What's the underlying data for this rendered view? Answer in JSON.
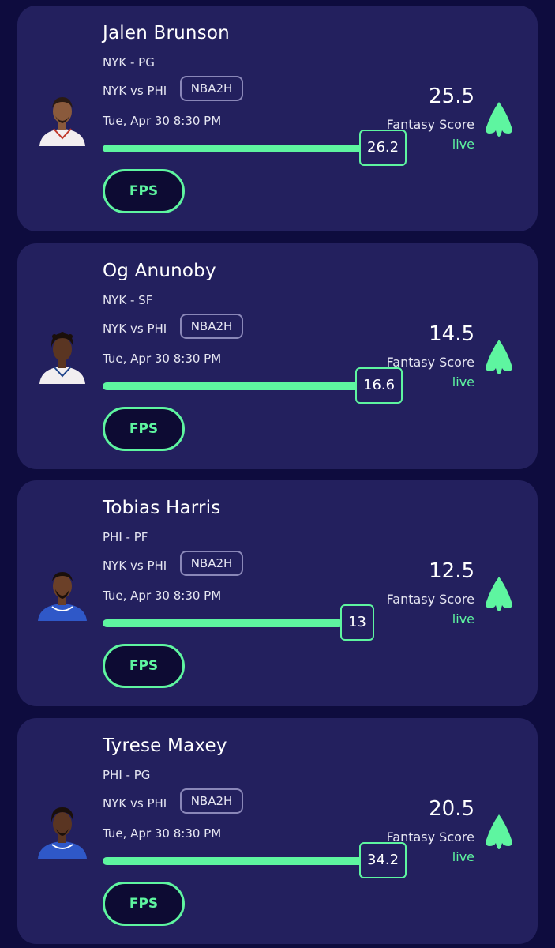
{
  "cards": [
    {
      "player_name": "Jalen Brunson",
      "team_position": "NYK - PG",
      "matchup": "NYK vs PHI",
      "league": "NBA2H",
      "datetime": "Tue, Apr 30 8:30 PM",
      "current_value": "26.2",
      "line_value": "25.5",
      "score_label": "Fantasy Score",
      "status": "live",
      "button_label": "FPS",
      "jersey_color": "#f2eef0",
      "skin_color": "#8a5a3c"
    },
    {
      "player_name": "Og Anunoby",
      "team_position": "NYK - SF",
      "matchup": "NYK vs PHI",
      "league": "NBA2H",
      "datetime": "Tue, Apr 30 8:30 PM",
      "current_value": "16.6",
      "line_value": "14.5",
      "score_label": "Fantasy Score",
      "status": "live",
      "button_label": "FPS",
      "jersey_color": "#f2eef0",
      "skin_color": "#5a3522"
    },
    {
      "player_name": "Tobias Harris",
      "team_position": "PHI - PF",
      "matchup": "NYK vs PHI",
      "league": "NBA2H",
      "datetime": "Tue, Apr 30 8:30 PM",
      "current_value": "13",
      "line_value": "12.5",
      "score_label": "Fantasy Score",
      "status": "live",
      "button_label": "FPS",
      "jersey_color": "#2f58c8",
      "skin_color": "#6b4028"
    },
    {
      "player_name": "Tyrese Maxey",
      "team_position": "PHI - PG",
      "matchup": "NYK vs PHI",
      "league": "NBA2H",
      "datetime": "Tue, Apr 30 8:30 PM",
      "current_value": "34.2",
      "line_value": "20.5",
      "score_label": "Fantasy Score",
      "status": "live",
      "button_label": "FPS",
      "jersey_color": "#2f58c8",
      "skin_color": "#5a3522"
    }
  ],
  "colors": {
    "page_bg": "#0e0c3e",
    "card_bg": "#23205e",
    "accent": "#5ef5a0"
  }
}
